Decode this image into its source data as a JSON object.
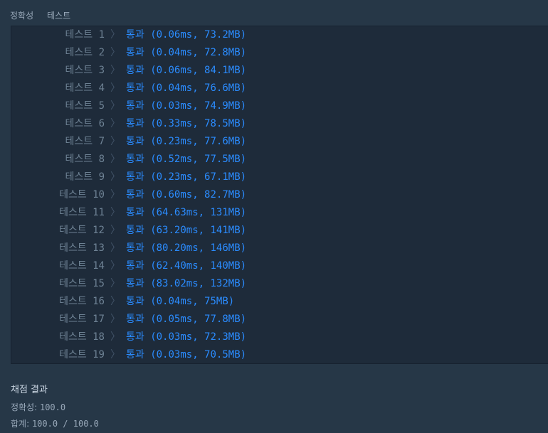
{
  "tabs": {
    "accuracy": "정확성",
    "test": "테스트"
  },
  "tests": [
    {
      "label": "테스트 1",
      "result": "통과 (0.06ms, 73.2MB)"
    },
    {
      "label": "테스트 2",
      "result": "통과 (0.04ms, 72.8MB)"
    },
    {
      "label": "테스트 3",
      "result": "통과 (0.06ms, 84.1MB)"
    },
    {
      "label": "테스트 4",
      "result": "통과 (0.04ms, 76.6MB)"
    },
    {
      "label": "테스트 5",
      "result": "통과 (0.03ms, 74.9MB)"
    },
    {
      "label": "테스트 6",
      "result": "통과 (0.33ms, 78.5MB)"
    },
    {
      "label": "테스트 7",
      "result": "통과 (0.23ms, 77.6MB)"
    },
    {
      "label": "테스트 8",
      "result": "통과 (0.52ms, 77.5MB)"
    },
    {
      "label": "테스트 9",
      "result": "통과 (0.23ms, 67.1MB)"
    },
    {
      "label": "테스트 10",
      "result": "통과 (0.60ms, 82.7MB)"
    },
    {
      "label": "테스트 11",
      "result": "통과 (64.63ms, 131MB)"
    },
    {
      "label": "테스트 12",
      "result": "통과 (63.20ms, 141MB)"
    },
    {
      "label": "테스트 13",
      "result": "통과 (80.20ms, 146MB)"
    },
    {
      "label": "테스트 14",
      "result": "통과 (62.40ms, 140MB)"
    },
    {
      "label": "테스트 15",
      "result": "통과 (83.02ms, 132MB)"
    },
    {
      "label": "테스트 16",
      "result": "통과 (0.04ms, 75MB)"
    },
    {
      "label": "테스트 17",
      "result": "통과 (0.05ms, 77.8MB)"
    },
    {
      "label": "테스트 18",
      "result": "통과 (0.03ms, 72.3MB)"
    },
    {
      "label": "테스트 19",
      "result": "통과 (0.03ms, 70.5MB)"
    }
  ],
  "separator": "〉",
  "summary": {
    "title": "채점 결과",
    "accuracy_label": "정확성: ",
    "accuracy_value": "100.0",
    "total_label": "합계: ",
    "total_value": "100.0 / 100.0"
  },
  "colors": {
    "pass": "#2b8cff",
    "background": "#263747",
    "panel": "#1e2b3a"
  }
}
